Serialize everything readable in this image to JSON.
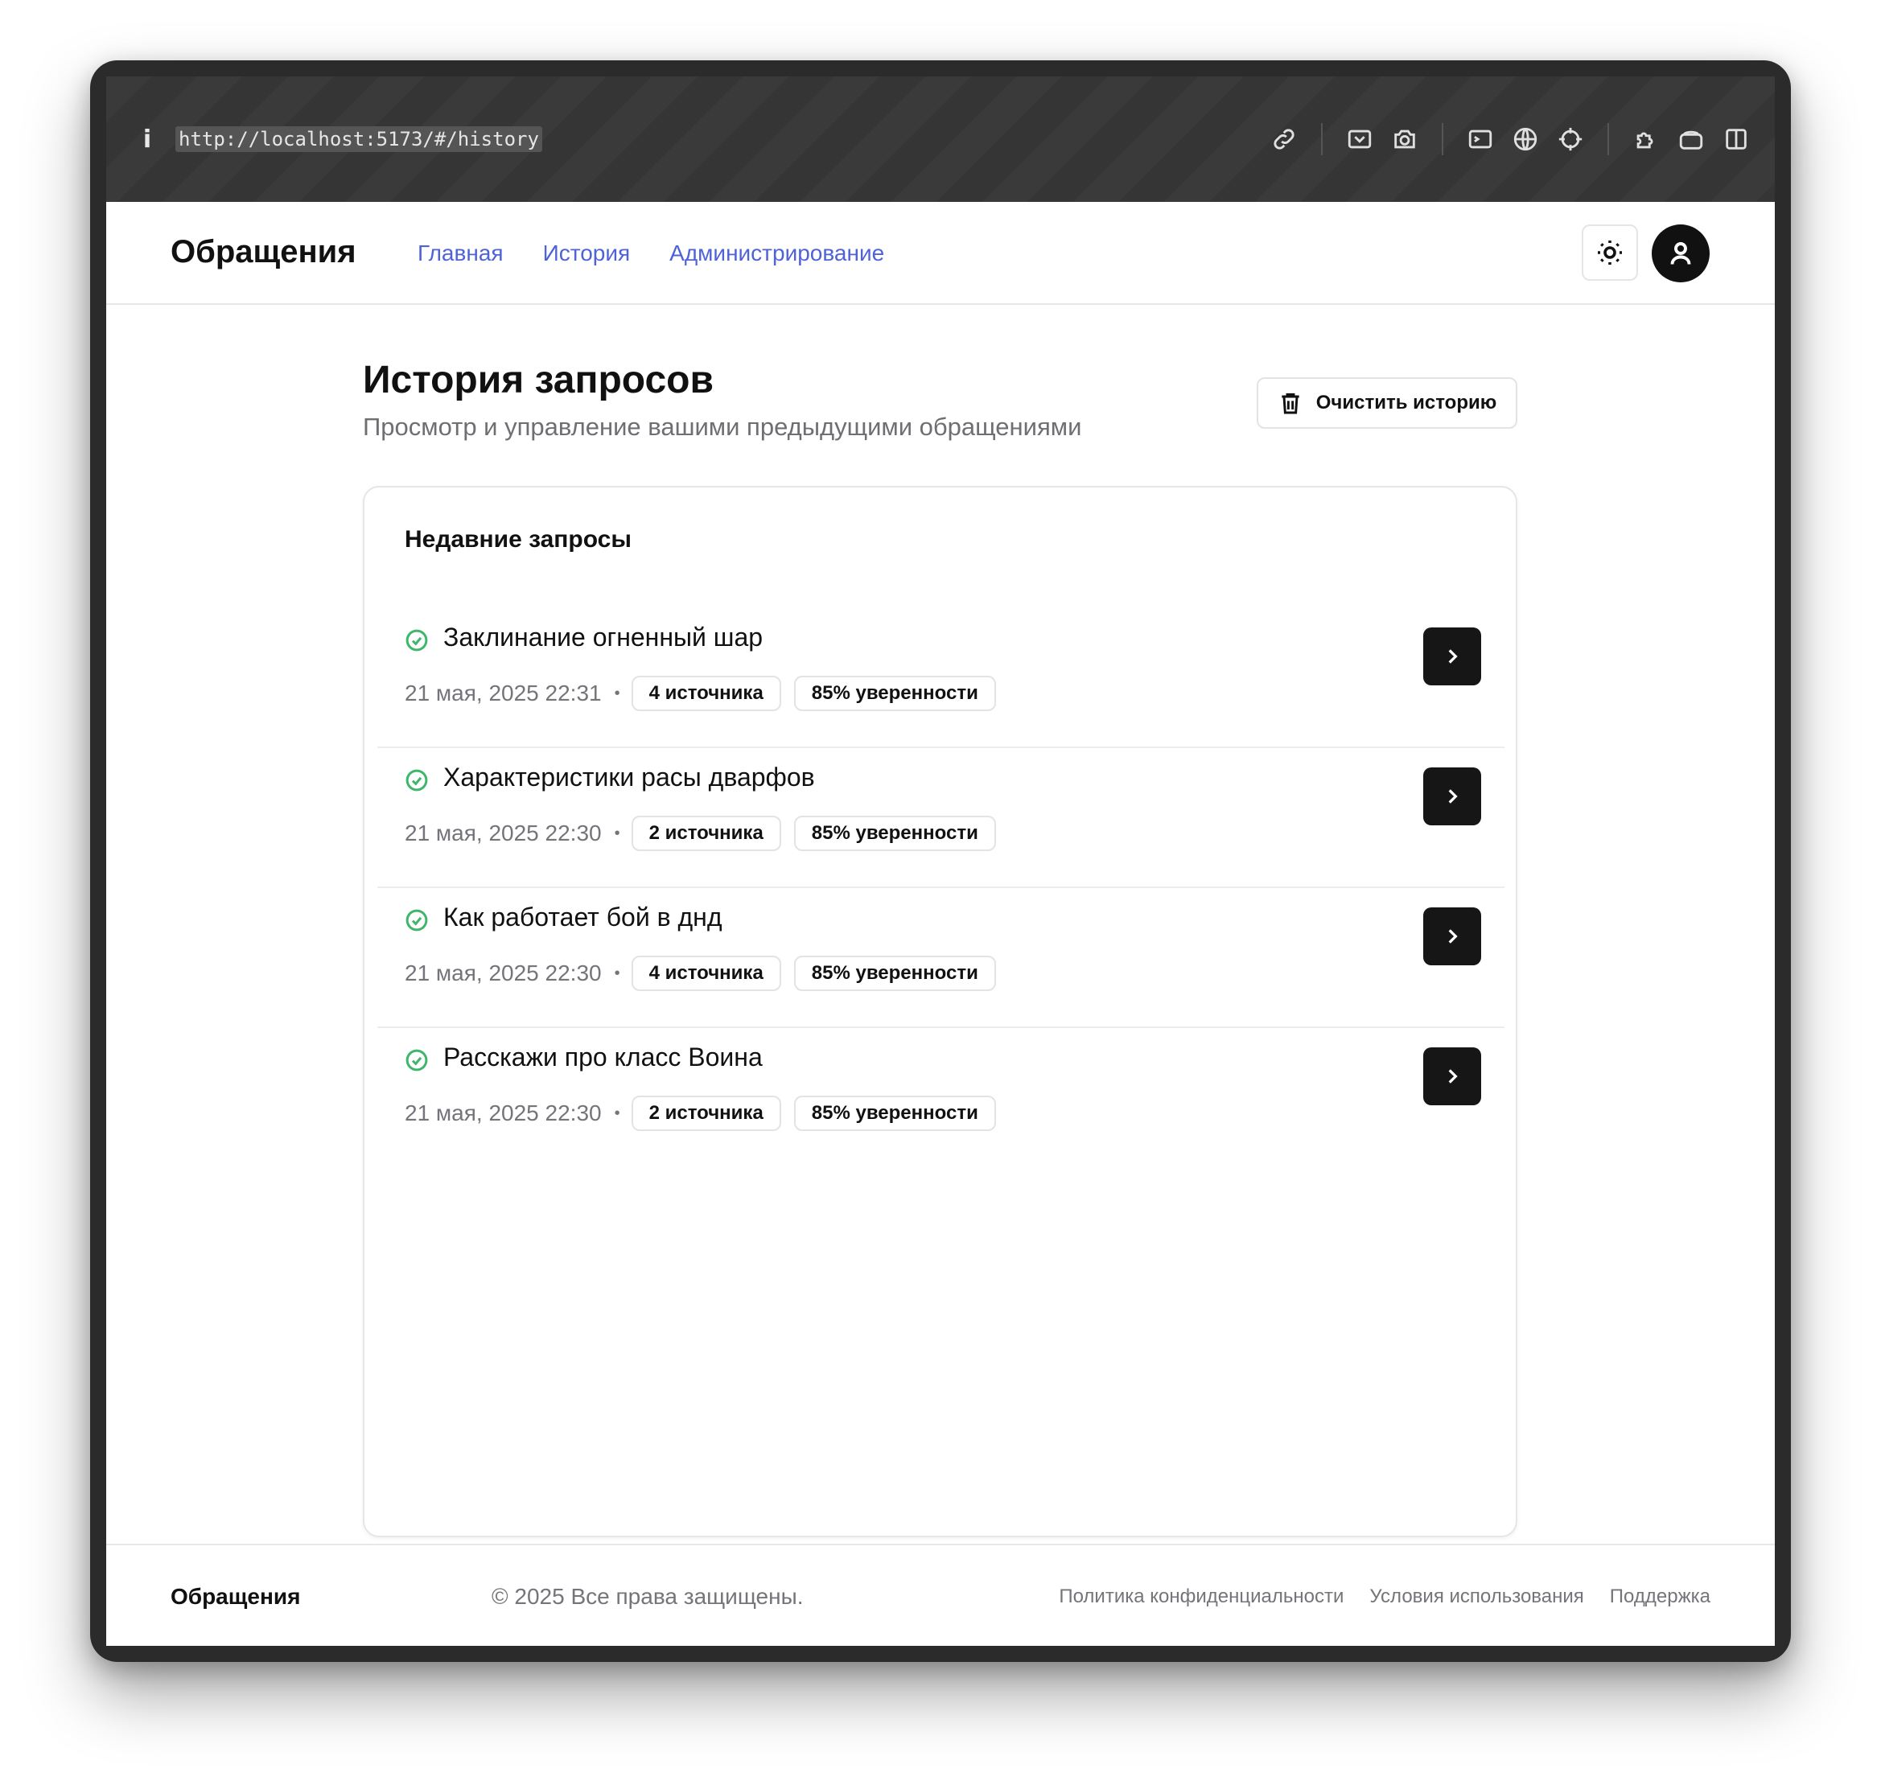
{
  "browser": {
    "url": "http://localhost:5173/#/history",
    "info_glyph": "i",
    "toolbar_icons": [
      "link-icon",
      "screenshot-region-icon",
      "camera-icon",
      "terminal-icon",
      "globe-icon",
      "crosshair-icon",
      "extension-icon",
      "off-toggle-icon",
      "sidebar-icon"
    ]
  },
  "header": {
    "brand": "Обращения",
    "nav": [
      "Главная",
      "История",
      "Администрирование"
    ],
    "nav_color": "#4f63d8"
  },
  "page": {
    "title": "История запросов",
    "subtitle": "Просмотр и управление вашими предыдущими обращениями",
    "clear_button": "Очистить историю"
  },
  "card": {
    "title": "Недавние запросы",
    "items": [
      {
        "title": "Заклинание огненный шар",
        "date": "21 мая, 2025 22:31",
        "sources": "4 источника",
        "confidence": "85% уверенности"
      },
      {
        "title": "Характеристики расы дварфов",
        "date": "21 мая, 2025 22:30",
        "sources": "2 источника",
        "confidence": "85% уверенности"
      },
      {
        "title": "Как работает бой в днд",
        "date": "21 мая, 2025 22:30",
        "sources": "4 источника",
        "confidence": "85% уверенности"
      },
      {
        "title": "Расскажи про класс Воина",
        "date": "21 мая, 2025 22:30",
        "sources": "2 источника",
        "confidence": "85% уверенности"
      }
    ],
    "status_color": "#3fb66b",
    "separator": "•"
  },
  "footer": {
    "brand": "Обращения",
    "copyright": "© 2025 Все права защищены.",
    "links": [
      "Политика конфиденциальности",
      "Условия использования",
      "Поддержка"
    ]
  }
}
